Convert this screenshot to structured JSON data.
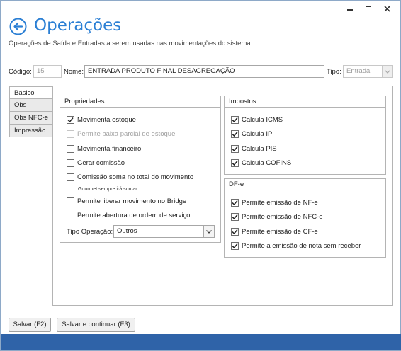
{
  "header": {
    "title": "Operações",
    "subtitle": "Operações de Saída e Entradas a serem usadas nas movimentações do sistema"
  },
  "form": {
    "codigo_label": "Código:",
    "codigo_value": "15",
    "nome_label": "Nome:",
    "nome_value": "ENTRADA PRODUTO FINAL DESAGREGAÇÃO",
    "tipo_label": "Tipo:",
    "tipo_value": "Entrada"
  },
  "tabs": [
    {
      "label": "Básico",
      "active": true
    },
    {
      "label": "Obs",
      "active": false
    },
    {
      "label": "Obs NFC-e",
      "active": false
    },
    {
      "label": "Impressão",
      "active": false
    }
  ],
  "propriedades": {
    "title": "Propriedades",
    "items": [
      {
        "label": "Movimenta estoque",
        "checked": true,
        "enabled": true
      },
      {
        "label": "Permite baixa parcial de estoque",
        "checked": false,
        "enabled": false
      },
      {
        "label": "Movimenta financeiro",
        "checked": false,
        "enabled": true
      },
      {
        "label": "Gerar comissão",
        "checked": false,
        "enabled": true
      },
      {
        "label": "Comissão soma no total do movimento",
        "checked": false,
        "enabled": true
      },
      {
        "label": "Permite liberar movimento no Bridge",
        "checked": false,
        "enabled": true
      },
      {
        "label": "Permite abertura de ordem de serviço",
        "checked": false,
        "enabled": true
      }
    ],
    "note": "Gourmet sempre irá somar",
    "tipo_operacao_label": "Tipo Operação:",
    "tipo_operacao_value": "Outros"
  },
  "impostos": {
    "title": "Impostos",
    "items": [
      {
        "label": "Calcula ICMS",
        "checked": true
      },
      {
        "label": "Calcula IPI",
        "checked": true
      },
      {
        "label": "Calcula PIS",
        "checked": true
      },
      {
        "label": "Calcula COFINS",
        "checked": true
      }
    ]
  },
  "dfe": {
    "title": "DF-e",
    "items": [
      {
        "label": "Permite emissão de NF-e",
        "checked": true
      },
      {
        "label": "Permite emissão de NFC-e",
        "checked": true
      },
      {
        "label": "Permite emissão de CF-e",
        "checked": true
      },
      {
        "label": "Permite a emissão de nota sem receber",
        "checked": true
      }
    ]
  },
  "buttons": {
    "salvar": "Salvar (F2)",
    "salvar_continuar": "Salvar e continuar (F3)"
  },
  "colors": {
    "accent": "#2b7fd4",
    "footer": "#2f63a8"
  }
}
